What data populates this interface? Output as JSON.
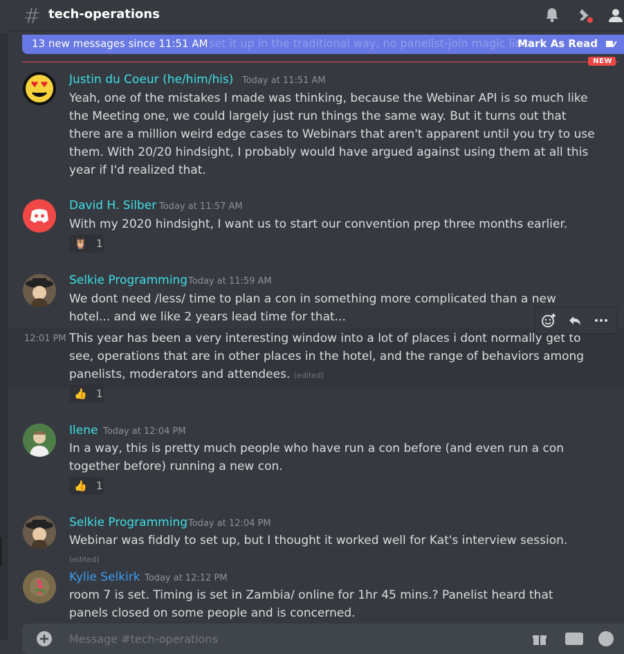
{
  "channel": {
    "name": "tech-operations",
    "hash_icon": "#"
  },
  "notification_bar": {
    "text": "13 new messages since 11:51 AM",
    "ghost_text": "set it up in the traditional way, no panelist-join magic links",
    "mark_read_label": "Mark As Read"
  },
  "new_badge": "NEW",
  "messages": [
    {
      "author": "Justin du Coeur (he/him/his)",
      "timestamp": "Today at 11:51 AM",
      "text": "Yeah, one of the mistakes I made was thinking, because the Webinar API is so much like the Meeting one, we could largely just run things the same way.  But it turns out that there are a million weird edge cases to Webinars that aren't apparent until you try to use them.  With 20/20 hindsight, I probably would have argued against using them at all this year if I'd realized that."
    },
    {
      "author": "David H. Silber",
      "timestamp": "Today at 11:57 AM",
      "text": "With my 2020 hindsight, I want us to start our convention prep three months earlier.",
      "reaction": {
        "emoji": "🦉",
        "count": "1"
      }
    },
    {
      "author": "Selkie Programming",
      "timestamp": "Today at 11:59 AM",
      "text": "We dont need /less/ time to plan a con in something more complicated than a new hotel... and we like 2 years lead time for that..."
    },
    {
      "side_timestamp": "12:01 PM",
      "text": "This year has been a very interesting window into a lot of places i dont normally get to see, operations that are in other places in the hotel, and the range of behaviors among panelists, moderators and attendees.",
      "edited": "(edited)",
      "reaction": {
        "emoji": "👍",
        "count": "1"
      }
    },
    {
      "author": "Ilene",
      "timestamp": "Today at 12:04 PM",
      "text": "In a way, this is pretty much people who have run a con before (and even run a con together before) running a new con.",
      "reaction": {
        "emoji": "👍",
        "count": "1"
      }
    },
    {
      "author": "Selkie Programming",
      "timestamp": "Today at 12:04 PM",
      "text": "Webinar was fiddly to set up, but I thought it worked well for Kat's interview session.",
      "edited": "(edited)"
    },
    {
      "author": "Kylie Selkirk",
      "timestamp": "Today at 12:12 PM",
      "text": "room 7 is set. Timing is set in Zambia/ online for 1hr 45 mins.? Panelist heard that panels closed on some people and is concerned."
    }
  ],
  "input": {
    "placeholder": "Message #tech-operations"
  },
  "colors": {
    "background": "#36393f",
    "username_cyan": "#3ee0e6",
    "username_blue": "#3c9cf2",
    "notification_bar": "#6878e4",
    "new_line": "#f04747"
  },
  "icons": [
    "bell-icon",
    "pin-icon",
    "members-icon",
    "mark-read-icon",
    "add-reaction-icon",
    "reply-icon",
    "more-icon",
    "attach-icon",
    "gift-icon",
    "gif-icon",
    "emoji-icon"
  ]
}
